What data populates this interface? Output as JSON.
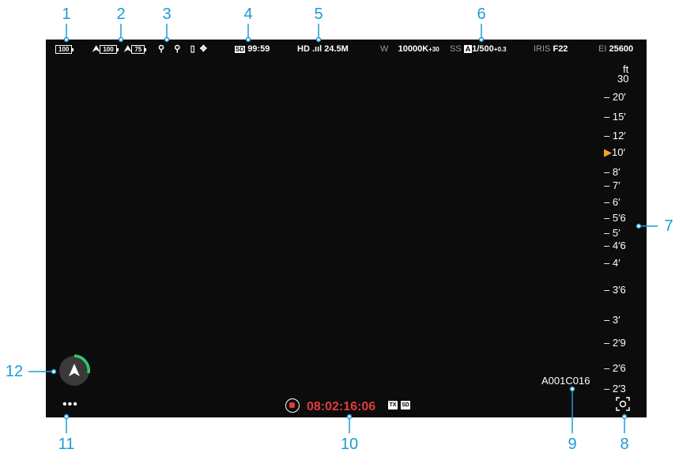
{
  "callouts": [
    "1",
    "2",
    "3",
    "4",
    "5",
    "6",
    "7",
    "8",
    "9",
    "10",
    "11",
    "12"
  ],
  "status": {
    "aircraft_battery": "100",
    "rc_battery": "100",
    "gimbal_battery": "75",
    "sd_remaining": "99:59",
    "video_quality": "HD",
    "bitrate": "24.5M",
    "wb_label": "W",
    "wb_value": "10000K",
    "wb_tint": "+30",
    "ss_label": "SS",
    "ss_mode": "A",
    "ss_value": "1/500",
    "ss_ev": "+0.3",
    "iris_label": "IRIS",
    "iris_value": "F22",
    "ei_label": "EI",
    "ei_value": "25600"
  },
  "focus_scale": {
    "unit": "ft",
    "marks": [
      "30",
      "– 20′",
      "– 15′",
      "– 12′",
      "10′",
      "– 8′",
      "– 7′",
      "– 6′",
      "– 5′6",
      "– 5′",
      "– 4′6",
      "– 4′",
      "– 3′6",
      "– 3′",
      "– 2′9",
      "– 2′6",
      "– 2′3"
    ],
    "active_marker": "▶"
  },
  "clip_name": "A001C016",
  "timecode": "08:02:16:06",
  "badges": {
    "tx": "TX",
    "sd": "SD"
  },
  "more_label": "•••",
  "colors": {
    "callout": "#1c9ad6",
    "recording": "#e23b3b",
    "focus_marker": "#f5a623",
    "nav_ring": "#2ecc71"
  },
  "icons": [
    "battery-icon",
    "rc-battery-icon",
    "gimbal-battery-icon",
    "motor-icon",
    "motor-icon",
    "gps-icon",
    "satellite-icon",
    "sd-card-icon",
    "signal-icon",
    "record-icon",
    "navigation-icon",
    "ar-focus-icon"
  ]
}
